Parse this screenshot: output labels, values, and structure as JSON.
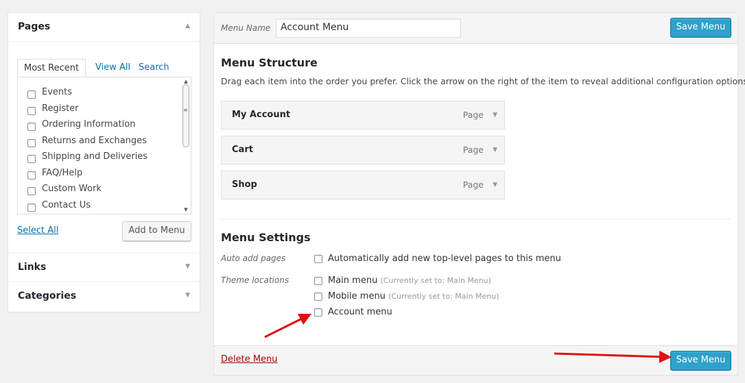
{
  "sidebar": {
    "pages": {
      "title": "Pages",
      "tabs": [
        "Most Recent",
        "View All",
        "Search"
      ],
      "items": [
        "Events",
        "Register",
        "Ordering Information",
        "Returns and Exchanges",
        "Shipping and Deliveries",
        "FAQ/Help",
        "Custom Work",
        "Contact Us"
      ],
      "select_all": "Select All",
      "add_button": "Add to Menu"
    },
    "links_title": "Links",
    "categories_title": "Categories"
  },
  "main": {
    "menu_name_label": "Menu Name",
    "menu_name_value": "Account Menu",
    "save_label": "Save Menu",
    "structure_title": "Menu Structure",
    "structure_desc": "Drag each item into the order you prefer. Click the arrow on the right of the item to reveal additional configuration options.",
    "items": [
      {
        "title": "My Account",
        "type": "Page"
      },
      {
        "title": "Cart",
        "type": "Page"
      },
      {
        "title": "Shop",
        "type": "Page"
      }
    ],
    "settings_title": "Menu Settings",
    "auto_add_label": "Auto add pages",
    "auto_add_option": "Automatically add new top-level pages to this menu",
    "theme_locations_label": "Theme locations",
    "locations": [
      {
        "label": "Main menu",
        "note": "(Currently set to: Main Menu)"
      },
      {
        "label": "Mobile menu",
        "note": "(Currently set to: Main Menu)"
      },
      {
        "label": "Account menu",
        "note": ""
      }
    ],
    "delete_label": "Delete Menu"
  },
  "colors": {
    "accent": "#2ea2cc",
    "link": "#0073aa",
    "delete": "#aa0000",
    "annotation_arrow": "#e01010"
  }
}
